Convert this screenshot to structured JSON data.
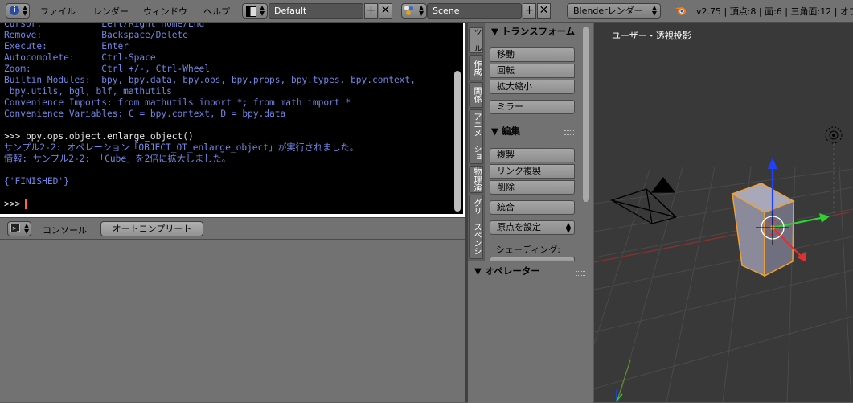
{
  "topbar": {
    "menus": [
      "ファイル",
      "レンダー",
      "ウィンドウ",
      "ヘルプ"
    ],
    "screen_layout": "Default",
    "scene": "Scene",
    "render_engine": "Blenderレンダー",
    "stats": "v2.75 | 頂点:8 | 面:6 | 三角面:12 | オブジ"
  },
  "console": {
    "lines": [
      {
        "text": "Cursor:           Left/Right Home/End",
        "color": "blue"
      },
      {
        "text": "Remove:           Backspace/Delete",
        "color": "blue"
      },
      {
        "text": "Execute:          Enter",
        "color": "blue"
      },
      {
        "text": "Autocomplete:     Ctrl-Space",
        "color": "blue"
      },
      {
        "text": "Zoom:             Ctrl +/-, Ctrl-Wheel",
        "color": "blue"
      },
      {
        "text": "Builtin Modules:  bpy, bpy.data, bpy.ops, bpy.props, bpy.types, bpy.context,",
        "color": "blue"
      },
      {
        "text": " bpy.utils, bgl, blf, mathutils",
        "color": "blue"
      },
      {
        "text": "Convenience Imports: from mathutils import *; from math import *",
        "color": "blue"
      },
      {
        "text": "Convenience Variables: C = bpy.context, D = bpy.data",
        "color": "blue"
      },
      {
        "text": "",
        "color": "blue"
      },
      {
        "text": ">>> bpy.ops.object.enlarge_object()",
        "color": "white"
      },
      {
        "text": "サンプル2-2: オペレーション「OBJECT_OT_enlarge_object」が実行されました。",
        "color": "blue"
      },
      {
        "text": "情報: サンプル2-2: 「Cube」を2倍に拡大しました。",
        "color": "blue"
      },
      {
        "text": "",
        "color": "blue"
      },
      {
        "text": "{'FINISHED'}",
        "color": "blue"
      },
      {
        "text": "",
        "color": "blue"
      },
      {
        "text": ">>> ",
        "color": "white"
      }
    ],
    "header_label": "コンソール",
    "autocomplete_button": "オートコンプリート"
  },
  "toolshelf": {
    "tabs": [
      "ツール",
      "作成",
      "関係",
      "アニメーション",
      "物理演算",
      "グリースペンシル"
    ],
    "transform_header": "トランスフォーム",
    "translate": "移動",
    "rotate": "回転",
    "scale": "拡大縮小",
    "mirror": "ミラー",
    "edit_header": "編集",
    "duplicate": "複製",
    "duplicate_linked": "リンク複製",
    "delete": "削除",
    "join": "統合",
    "set_origin": "原点を設定",
    "shading_label": "シェーディング:",
    "operator_header": "オペレーター"
  },
  "viewport": {
    "label": "ユーザー・透視投影"
  },
  "colors": {
    "console_bg": "#000000",
    "console_text_blue": "#7187e6",
    "selection_orange": "#f0a030",
    "axis_x": "#e03030",
    "axis_y": "#30d030",
    "axis_z": "#2040ff"
  }
}
